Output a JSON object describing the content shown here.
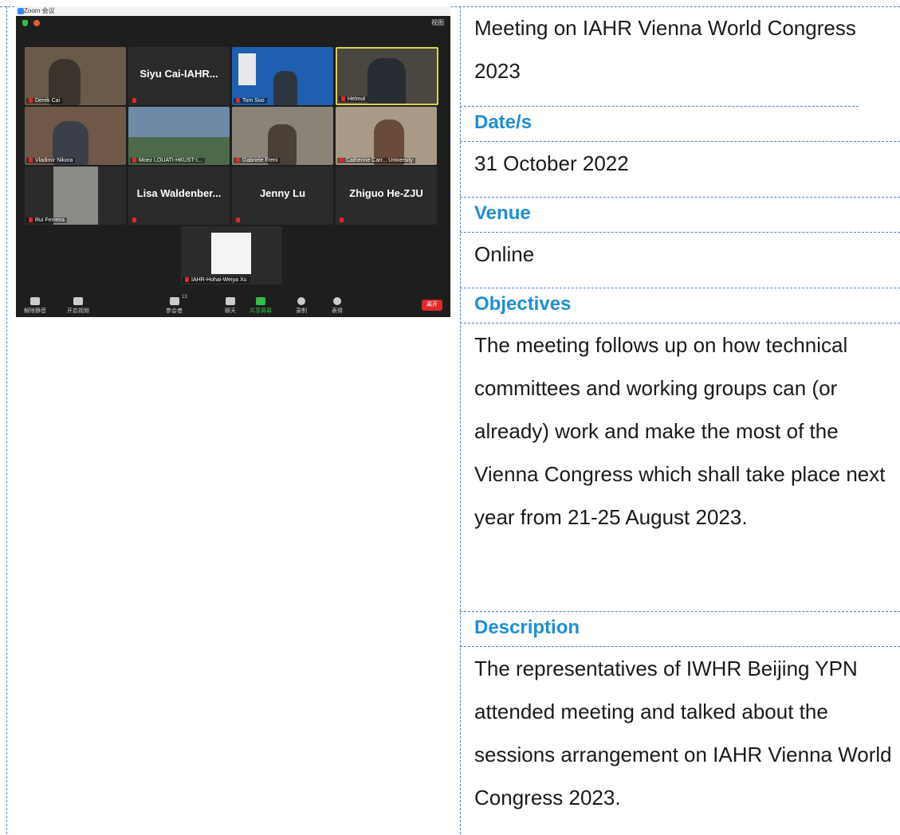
{
  "zoom": {
    "window_title": "Zoom 会议",
    "view_label": "视图",
    "tiles": [
      {
        "label": "Derek Cai",
        "center_name": ""
      },
      {
        "label": "",
        "center_name": "Siyu Cai-IAHR..."
      },
      {
        "label": "Tom Soo",
        "center_name": ""
      },
      {
        "label": "Helmut",
        "center_name": ""
      },
      {
        "label": "Vladimir Nikora",
        "center_name": ""
      },
      {
        "label": "Moez LOUATI-HKUST-I...",
        "center_name": ""
      },
      {
        "label": "Gabriele Freni",
        "center_name": ""
      },
      {
        "label": "Catherine Carr... University",
        "center_name": ""
      },
      {
        "label": "Rui Ferreira",
        "center_name": ""
      },
      {
        "label": "",
        "center_name": "Lisa  Waldenber..."
      },
      {
        "label": "",
        "center_name": "Jenny Lu"
      },
      {
        "label": "",
        "center_name": "Zhiguo He-ZJU"
      },
      {
        "label": "IAHR-Hohai-Weiya Xu",
        "center_name": ""
      }
    ],
    "controls": [
      "解除静音",
      "开启视频",
      "参会者",
      "聊天",
      "共享屏幕",
      "录制",
      "表情"
    ],
    "participant_count": "13",
    "leave_label": "离开"
  },
  "info": {
    "title": "Meeting on IAHR Vienna World Congress 2023",
    "date_heading": "Date/s",
    "date_value": "31 October 2022",
    "venue_heading": "Venue",
    "venue_value": "Online",
    "objectives_heading": "Objectives",
    "objectives_text": "The meeting follows up on how technical committees and working groups can (or already) work and make the most of the Vienna Congress which shall take place next year from 21-25 August 2023.",
    "description_heading": "Description",
    "description_text": "The representatives of IWHR Beijing YPN attended meeting and talked about the sessions arrangement on IAHR Vienna World Congress 2023."
  }
}
